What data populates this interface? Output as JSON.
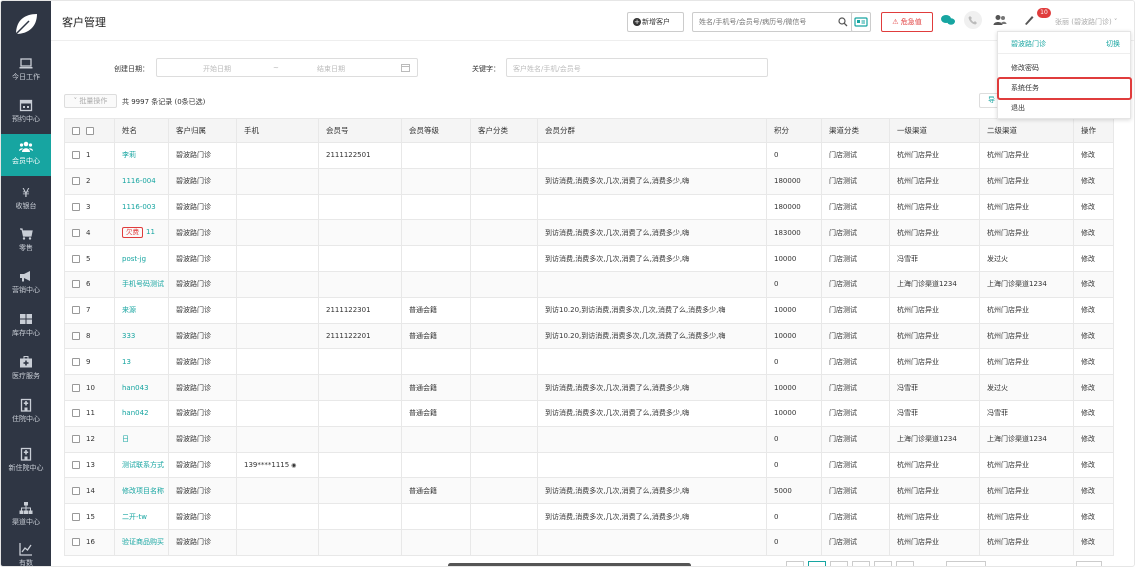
{
  "app": {
    "title": "客户管理"
  },
  "sidebar": {
    "items": [
      {
        "label": "今日工作",
        "icon": "laptop-icon"
      },
      {
        "label": "预约中心",
        "icon": "calendar-icon"
      },
      {
        "label": "会员中心",
        "icon": "members-icon"
      },
      {
        "label": "收银台",
        "icon": "yen-icon"
      },
      {
        "label": "零售",
        "icon": "cart-icon"
      },
      {
        "label": "营销中心",
        "icon": "megaphone-icon"
      },
      {
        "label": "库存中心",
        "icon": "grid-icon"
      },
      {
        "label": "医疗服务",
        "icon": "medical-kit-icon"
      },
      {
        "label": "住院中心",
        "icon": "hospital-icon"
      },
      {
        "label": "新住院中心",
        "icon": "hospital-icon"
      },
      {
        "label": "渠道中心",
        "icon": "org-chart-icon"
      },
      {
        "label": "有数",
        "icon": "chart-icon"
      }
    ],
    "active_index": 2
  },
  "header": {
    "new_customer": "新增客户",
    "search_placeholder": "姓名/手机号/会员号/病历号/微信号",
    "urgent": "危急值",
    "badge": "10",
    "user": "张丽 (碧波路门诊)"
  },
  "dropdown": {
    "store": "碧波路门诊",
    "switch": "切换",
    "items": [
      "修改密码",
      "系统任务",
      "退出"
    ],
    "highlighted": "系统任务"
  },
  "filters": {
    "created_label": "创建日期：",
    "start_placeholder": "开始日期",
    "sep": "~",
    "end_placeholder": "结束日期",
    "keyword_label": "关键字：",
    "keyword_placeholder": "客户姓名/手机/会员号"
  },
  "toolbar": {
    "batch": "批量操作",
    "count": "共 9997 条记录 (0条已选)",
    "export": "导"
  },
  "table": {
    "columns": [
      "姓名",
      "客户归属",
      "手机",
      "会员号",
      "会员等级",
      "客户分类",
      "会员分群",
      "积分",
      "渠道分类",
      "一级渠道",
      "二级渠道",
      "操作"
    ],
    "rows": [
      {
        "no": "1",
        "name": "李莉",
        "owner": "碧波路门诊",
        "phone": "",
        "member_no": "2111122501",
        "level": "",
        "category": "",
        "group": "",
        "points": "0",
        "channel_type": "门店测试",
        "ch1": "杭州门店异业",
        "ch2": "杭州门店异业",
        "op": "修改"
      },
      {
        "no": "2",
        "name": "1116-004",
        "owner": "碧波路门诊",
        "phone": "",
        "member_no": "",
        "level": "",
        "category": "",
        "group": "到访消费,消费多次,几次,消费了么,消费多少,嗨",
        "points": "180000",
        "channel_type": "门店测试",
        "ch1": "杭州门店异业",
        "ch2": "杭州门店异业",
        "op": "修改"
      },
      {
        "no": "3",
        "name": "1116-003",
        "owner": "碧波路门诊",
        "phone": "",
        "member_no": "",
        "level": "",
        "category": "",
        "group": "",
        "points": "180000",
        "channel_type": "门店测试",
        "ch1": "杭州门店异业",
        "ch2": "杭州门店异业",
        "op": "修改"
      },
      {
        "no": "4",
        "name": "11",
        "owe": "欠费",
        "owner": "碧波路门诊",
        "phone": "",
        "member_no": "",
        "level": "",
        "category": "",
        "group": "到访消费,消费多次,几次,消费了么,消费多少,嗨",
        "points": "183000",
        "channel_type": "门店测试",
        "ch1": "杭州门店异业",
        "ch2": "杭州门店异业",
        "op": "修改"
      },
      {
        "no": "5",
        "name": "post-jg",
        "owner": "碧波路门诊",
        "phone": "",
        "member_no": "",
        "level": "",
        "category": "",
        "group": "到访消费,消费多次,几次,消费了么,消费多少,嗨",
        "points": "10000",
        "channel_type": "门店测试",
        "ch1": "冯雪菲",
        "ch2": "发过火",
        "op": "修改"
      },
      {
        "no": "6",
        "name": "手机号码测试",
        "owner": "碧波路门诊",
        "phone": "",
        "member_no": "",
        "level": "",
        "category": "",
        "group": "",
        "points": "0",
        "channel_type": "门店测试",
        "ch1": "上海门诊渠道1234",
        "ch2": "上海门诊渠道1234",
        "op": "修改"
      },
      {
        "no": "7",
        "name": "来源",
        "owner": "碧波路门诊",
        "phone": "",
        "member_no": "2111122301",
        "level": "普通会籍",
        "category": "",
        "group": "到访10.20,到访消费,消费多次,几次,消费了么,消费多少,嗨",
        "points": "10000",
        "channel_type": "门店测试",
        "ch1": "杭州门店异业",
        "ch2": "杭州门店异业",
        "op": "修改"
      },
      {
        "no": "8",
        "name": "333",
        "owner": "碧波路门诊",
        "phone": "",
        "member_no": "2111122201",
        "level": "普通会籍",
        "category": "",
        "group": "到访10.20,到访消费,消费多次,几次,消费了么,消费多少,嗨",
        "points": "10000",
        "channel_type": "门店测试",
        "ch1": "杭州门店异业",
        "ch2": "杭州门店异业",
        "op": "修改"
      },
      {
        "no": "9",
        "name": "13",
        "owner": "碧波路门诊",
        "phone": "",
        "member_no": "",
        "level": "",
        "category": "",
        "group": "",
        "points": "0",
        "channel_type": "门店测试",
        "ch1": "杭州门店异业",
        "ch2": "杭州门店异业",
        "op": "修改"
      },
      {
        "no": "10",
        "name": "han043",
        "owner": "碧波路门诊",
        "phone": "",
        "member_no": "",
        "level": "普通会籍",
        "category": "",
        "group": "到访消费,消费多次,几次,消费了么,消费多少,嗨",
        "points": "10000",
        "channel_type": "门店测试",
        "ch1": "冯雪菲",
        "ch2": "发过火",
        "op": "修改"
      },
      {
        "no": "11",
        "name": "han042",
        "owner": "碧波路门诊",
        "phone": "",
        "member_no": "",
        "level": "普通会籍",
        "category": "",
        "group": "到访消费,消费多次,几次,消费了么,消费多少,嗨",
        "points": "10000",
        "channel_type": "门店测试",
        "ch1": "冯雪菲",
        "ch2": "冯雪菲",
        "op": "修改"
      },
      {
        "no": "12",
        "name": "日",
        "owner": "碧波路门诊",
        "phone": "",
        "member_no": "",
        "level": "",
        "category": "",
        "group": "",
        "points": "0",
        "channel_type": "门店测试",
        "ch1": "上海门诊渠道1234",
        "ch2": "上海门诊渠道1234",
        "op": "修改"
      },
      {
        "no": "13",
        "name": "测试联系方式",
        "owner": "碧波路门诊",
        "phone": "139****1115",
        "member_no": "",
        "level": "",
        "category": "",
        "group": "",
        "points": "0",
        "channel_type": "门店测试",
        "ch1": "杭州门店异业",
        "ch2": "杭州门店异业",
        "op": "修改"
      },
      {
        "no": "14",
        "name": "修改项目名称",
        "owner": "碧波路门诊",
        "phone": "",
        "member_no": "",
        "level": "普通会籍",
        "category": "",
        "group": "到访消费,消费多次,几次,消费了么,消费多少,嗨",
        "points": "5000",
        "channel_type": "门店测试",
        "ch1": "杭州门店异业",
        "ch2": "杭州门店异业",
        "op": "修改"
      },
      {
        "no": "15",
        "name": "二开-tw",
        "owner": "碧波路门诊",
        "phone": "",
        "member_no": "",
        "level": "",
        "category": "",
        "group": "到访消费,消费多次,几次,消费了么,消费多少,嗨",
        "points": "0",
        "channel_type": "门店测试",
        "ch1": "杭州门店异业",
        "ch2": "杭州门店异业",
        "op": "修改"
      },
      {
        "no": "16",
        "name": "验证商品购买",
        "owner": "碧波路门诊",
        "phone": "",
        "member_no": "",
        "level": "",
        "category": "",
        "group": "",
        "points": "0",
        "channel_type": "门店测试",
        "ch1": "杭州门店异业",
        "ch2": "杭州门店异业",
        "op": "修改"
      }
    ]
  },
  "colors": {
    "accent": "#17a5a1",
    "sidebar_bg": "#2f3644",
    "danger": "#e03c3c"
  }
}
